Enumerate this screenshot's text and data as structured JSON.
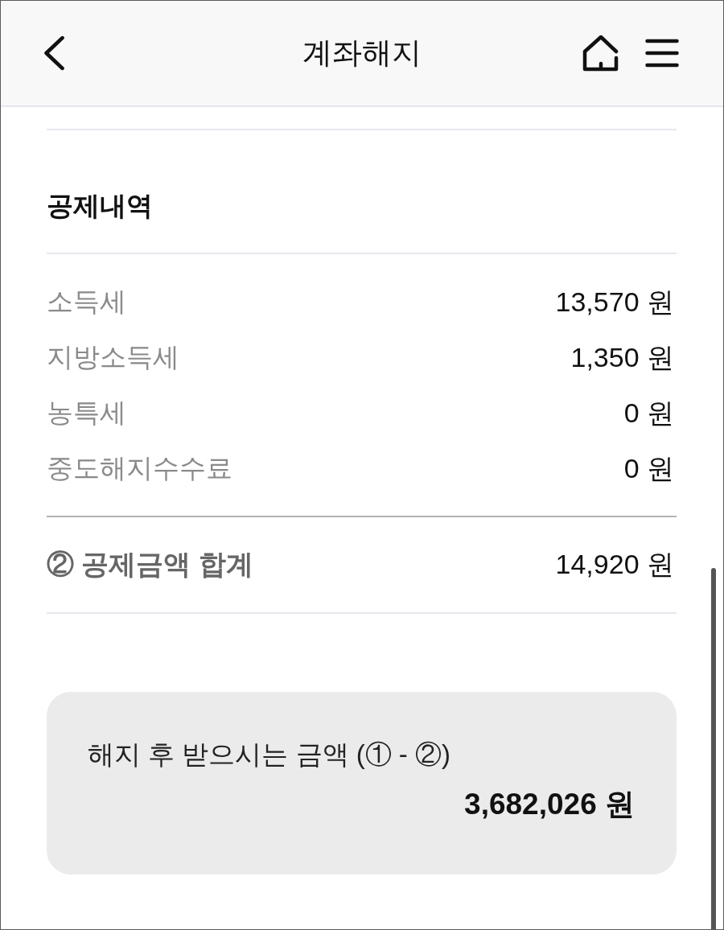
{
  "header": {
    "title": "계좌해지"
  },
  "deductions": {
    "title": "공제내역",
    "rows": [
      {
        "label": "소득세",
        "value": "13,570 원"
      },
      {
        "label": "지방소득세",
        "value": "1,350 원"
      },
      {
        "label": "농특세",
        "value": "0 원"
      },
      {
        "label": "중도해지수수료",
        "value": "0 원"
      }
    ]
  },
  "total": {
    "label": "② 공제금액 합계",
    "value": "14,920 원"
  },
  "result": {
    "label": "해지 후 받으시는 금액 (① - ②)",
    "amount": "3,682,026 원"
  }
}
